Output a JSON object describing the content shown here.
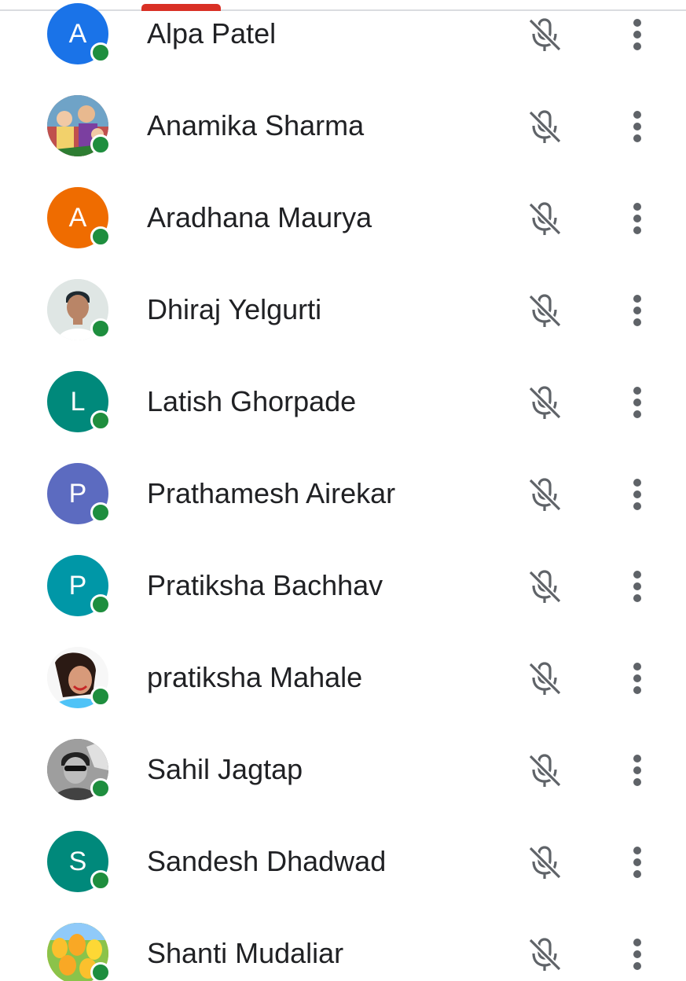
{
  "colors": {
    "presence": "#1e8e3e",
    "name_text": "#202124",
    "icon": "#5f6368",
    "indicator": "#d93025"
  },
  "participants": [
    {
      "name": "Alpa Patel",
      "initial": "A",
      "avatar_color": "#1a73e8",
      "avatar_type": "letter"
    },
    {
      "name": "Anamika Sharma",
      "initial": "",
      "avatar_color": "#9c6b5a",
      "avatar_type": "photo-deities"
    },
    {
      "name": "Aradhana Maurya",
      "initial": "A",
      "avatar_color": "#ef6c00",
      "avatar_type": "letter"
    },
    {
      "name": "Dhiraj Yelgurti",
      "initial": "",
      "avatar_color": "#e8eaed",
      "avatar_type": "photo-person"
    },
    {
      "name": "Latish Ghorpade",
      "initial": "L",
      "avatar_color": "#00897b",
      "avatar_type": "letter"
    },
    {
      "name": "Prathamesh Airekar",
      "initial": "P",
      "avatar_color": "#5c6bc0",
      "avatar_type": "letter"
    },
    {
      "name": "Pratiksha Bachhav",
      "initial": "P",
      "avatar_color": "#0097a7",
      "avatar_type": "letter"
    },
    {
      "name": "pratiksha Mahale",
      "initial": "",
      "avatar_color": "#f4f4f4",
      "avatar_type": "photo-selfie"
    },
    {
      "name": "Sahil Jagtap",
      "initial": "",
      "avatar_color": "#6d6d6d",
      "avatar_type": "photo-bw"
    },
    {
      "name": "Sandesh Dhadwad",
      "initial": "S",
      "avatar_color": "#00897b",
      "avatar_type": "letter"
    },
    {
      "name": "Shanti Mudaliar",
      "initial": "",
      "avatar_color": "#f9ab00",
      "avatar_type": "photo-tulips"
    }
  ],
  "icons": {
    "mic": "mic-off-icon",
    "more": "more-vert-icon",
    "presence": "online-status-dot"
  }
}
